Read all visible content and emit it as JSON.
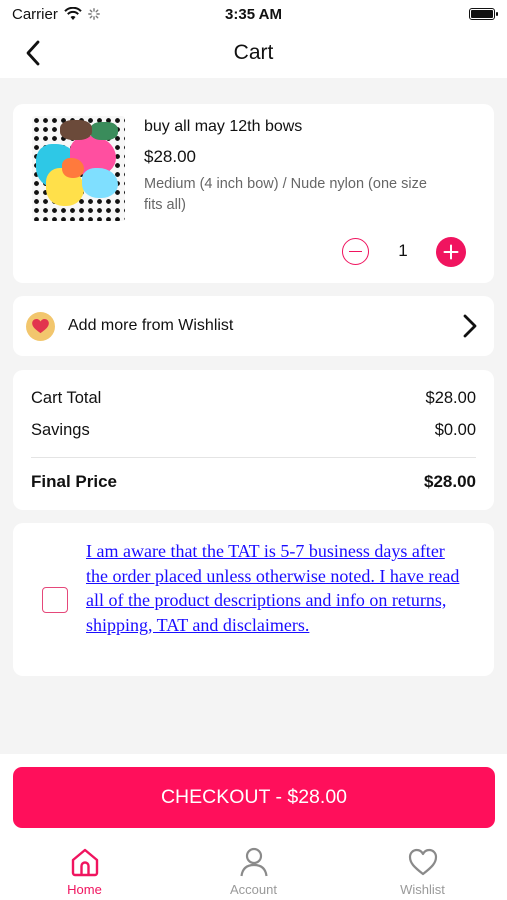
{
  "status_bar": {
    "carrier": "Carrier",
    "time": "3:35 AM"
  },
  "header": {
    "title": "Cart"
  },
  "cart_item": {
    "title": "buy all may 12th bows",
    "price": "$28.00",
    "variant": "Medium (4 inch bow) / Nude nylon (one size fits all)",
    "quantity": "1"
  },
  "wishlist": {
    "label": "Add more from Wishlist"
  },
  "totals": {
    "cart_total_label": "Cart Total",
    "cart_total_value": "$28.00",
    "savings_label": "Savings",
    "savings_value": "$0.00",
    "final_label": "Final Price",
    "final_value": "$28.00"
  },
  "terms": {
    "text": "I am aware that the TAT is 5-7 business days after the order placed unless otherwise noted. I have read all of the product descriptions and info on returns, shipping, TAT and disclaimers."
  },
  "checkout": {
    "label": "CHECKOUT - $28.00"
  },
  "tabs": [
    {
      "label": "Home",
      "icon": "home-icon"
    },
    {
      "label": "Account",
      "icon": "account-icon"
    },
    {
      "label": "Wishlist",
      "icon": "heart-icon"
    }
  ],
  "colors": {
    "accent": "#f0145f",
    "checkout": "#ff0f5b",
    "link": "#1a0dff",
    "wishlist_badge": "#f2c66d"
  }
}
